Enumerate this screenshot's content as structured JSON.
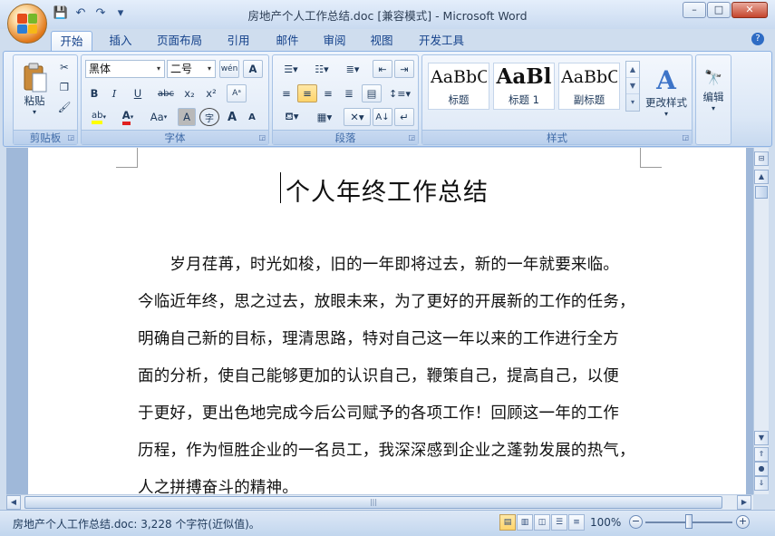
{
  "window": {
    "title": "房地产个人工作总结.doc [兼容模式] - Microsoft Word",
    "controls": {
      "minimize": "–",
      "maximize": "□",
      "close": "✕"
    }
  },
  "quick_access": {
    "save_icon": "floppy-disk",
    "undo_icon": "↶",
    "redo_icon": "↷",
    "customize_icon": "▾"
  },
  "tabs": [
    {
      "label": "开始",
      "active": true
    },
    {
      "label": "插入"
    },
    {
      "label": "页面布局"
    },
    {
      "label": "引用"
    },
    {
      "label": "邮件"
    },
    {
      "label": "审阅"
    },
    {
      "label": "视图"
    },
    {
      "label": "开发工具"
    }
  ],
  "ribbon": {
    "clipboard": {
      "label": "剪贴板",
      "paste": "粘贴"
    },
    "font": {
      "label": "字体",
      "font_name": "黑体",
      "font_size": "二号",
      "bold": "B",
      "italic": "I",
      "underline": "U",
      "strike": "abc",
      "subscript": "x₂",
      "superscript": "x²",
      "phonetic": "wén",
      "char_border": "A",
      "grow": "A",
      "shrink": "A",
      "change_case": "Aa",
      "shading": "A",
      "enclose": "字",
      "highlight_color": "#ffff00",
      "font_color": "#e02020"
    },
    "paragraph": {
      "label": "段落"
    },
    "styles": {
      "label": "样式",
      "items": [
        {
          "sample": "AaBbC",
          "name": "标题"
        },
        {
          "sample": "AaBl",
          "name": "标题 1"
        },
        {
          "sample": "AaBbC",
          "name": "副标题"
        }
      ],
      "change_styles": "更改样式"
    },
    "editing": {
      "label": "编辑"
    }
  },
  "document": {
    "title": "个人年终工作总结",
    "lines": [
      "　　岁月荏苒，时光如梭，旧的一年即将过去，新的一年就要来临。",
      "今临近年终，思之过去，放眼未来，为了更好的开展新的工作的任务，",
      "明确自己新的目标，理清思路，特对自己这一年以来的工作进行全方",
      "面的分析，使自己能够更加的认识自己，鞭策自己，提高自己，以便",
      "于更好，更出色地完成今后公司赋予的各项工作！回顾这一年的工作",
      "历程，作为恒胜企业的一名员工，我深深感到企业之蓬勃发展的热气，",
      "人之拼搏奋斗的精神。"
    ]
  },
  "status_bar": {
    "info": "房地产个人工作总结.doc: 3,228 个字符(近似值)。",
    "zoom": "100%"
  }
}
